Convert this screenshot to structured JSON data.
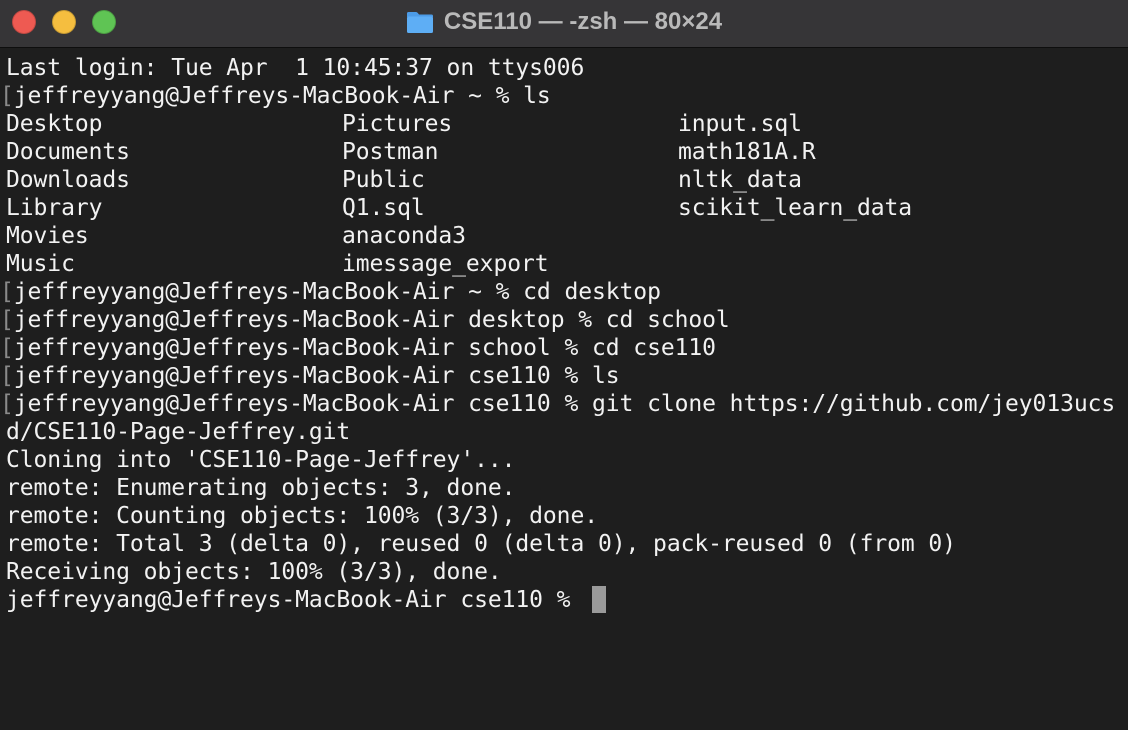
{
  "window": {
    "title": "CSE110 — -zsh — 80×24",
    "folder_icon": "folder-icon",
    "controls": [
      "close-button",
      "minimize-button",
      "zoom-button"
    ],
    "colors": {
      "close": "#ee5a52",
      "minimize": "#f5be3f",
      "zoom": "#5fc454",
      "folder": "#5aa9f2",
      "background": "#1e1e1e",
      "text": "#f2f2f2"
    }
  },
  "terminal": {
    "last_login": "Last login: Tue Apr  1 10:45:37 on ttys006",
    "prompt_lines": [
      "jeffreyyang@Jeffreys-MacBook-Air ~ % ls"
    ],
    "ls_columns": [
      [
        "Desktop",
        "Documents",
        "Downloads",
        "Library",
        "Movies",
        "Music"
      ],
      [
        "Pictures",
        "Postman",
        "Public",
        "Q1.sql",
        "anaconda3",
        "imessage_export"
      ],
      [
        "input.sql",
        "math181A.R",
        "nltk_data",
        "scikit_learn_data"
      ]
    ],
    "commands": [
      "jeffreyyang@Jeffreys-MacBook-Air ~ % cd desktop",
      "jeffreyyang@Jeffreys-MacBook-Air desktop % cd school",
      "jeffreyyang@Jeffreys-MacBook-Air school % cd cse110",
      "jeffreyyang@Jeffreys-MacBook-Air cse110 % ls",
      "jeffreyyang@Jeffreys-MacBook-Air cse110 % git clone https://github.com/jey013ucs"
    ],
    "wrapped": "d/CSE110-Page-Jeffrey.git",
    "output": [
      "Cloning into 'CSE110-Page-Jeffrey'...",
      "remote: Enumerating objects: 3, done.",
      "remote: Counting objects: 100% (3/3), done.",
      "remote: Total 3 (delta 0), reused 0 (delta 0), pack-reused 0 (from 0)",
      "Receiving objects: 100% (3/3), done."
    ],
    "current_prompt": "jeffreyyang@Jeffreys-MacBook-Air cse110 % "
  }
}
